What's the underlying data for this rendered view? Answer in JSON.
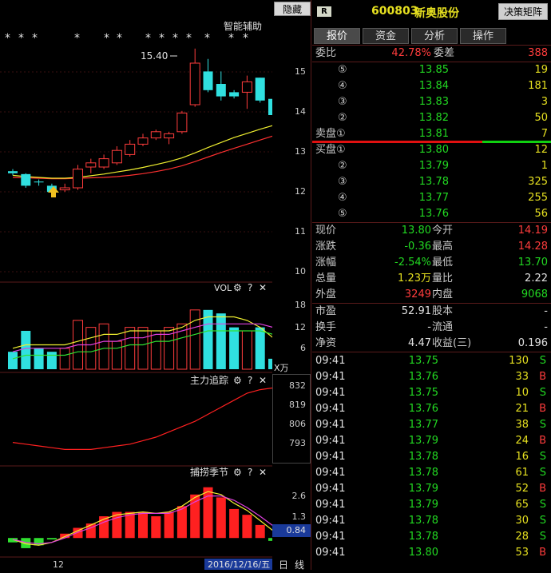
{
  "left_panel": {
    "hide_button": "隐藏>>",
    "smart_label": "智能辅助",
    "stars": [
      "*",
      "*",
      "*",
      "*",
      "*",
      "*",
      "*",
      "*",
      "*",
      "*",
      "*",
      "*",
      "*"
    ],
    "price_ticks": [
      "15",
      "14",
      "13",
      "12",
      "11",
      "10"
    ],
    "high_marker": "15.40",
    "vol_title": "VOL",
    "vol_ticks": [
      "18",
      "12",
      "6"
    ],
    "vol_unit": "X万",
    "main_title": "主力追踪",
    "main_ticks": [
      "832",
      "819",
      "806",
      "793"
    ],
    "season_title": "捕捞季节",
    "season_ticks": [
      "2.6",
      "1.3"
    ],
    "season_value": "0.84",
    "date_tick": "12",
    "date_label": "2016/12/16/五",
    "right_tail_1": "日",
    "right_tail_2": "线",
    "gear_icon": "⚙",
    "help_icon": "?",
    "close_icon": "✕"
  },
  "colors": {
    "up": "#ff3c3c",
    "down": "#30e0e0",
    "ma_yellow": "#f0f030",
    "ma_red": "#ff3030",
    "bg": "#000000",
    "grid": "#5a1a1a"
  },
  "header": {
    "badge": "R",
    "code": "600803",
    "name": "新奥股份",
    "decision_button": "决策矩阵"
  },
  "tabs": [
    "报价",
    "资金",
    "分析",
    "操作"
  ],
  "order_book": {
    "wei_bi_label": "委比",
    "wei_bi": "42.78%",
    "wei_cha_label": "委差",
    "wei_cha": "388",
    "asks": [
      {
        "level": "⑤",
        "price": "13.85",
        "vol": "19"
      },
      {
        "level": "④",
        "price": "13.84",
        "vol": "181"
      },
      {
        "level": "③",
        "price": "13.83",
        "vol": "3"
      },
      {
        "level": "②",
        "price": "13.82",
        "vol": "50"
      },
      {
        "level": "卖盘①",
        "price": "13.81",
        "vol": "7"
      }
    ],
    "bids": [
      {
        "level": "买盘①",
        "price": "13.80",
        "vol": "12"
      },
      {
        "level": "②",
        "price": "13.79",
        "vol": "1"
      },
      {
        "level": "③",
        "price": "13.78",
        "vol": "325"
      },
      {
        "level": "④",
        "price": "13.77",
        "vol": "255"
      },
      {
        "level": "⑤",
        "price": "13.76",
        "vol": "56"
      }
    ]
  },
  "quote": [
    {
      "l1": "现价",
      "v1": "13.80",
      "c1": "green",
      "l2": "今开",
      "v2": "14.19",
      "c2": "red"
    },
    {
      "l1": "涨跌",
      "v1": "-0.36",
      "c1": "green",
      "l2": "最高",
      "v2": "14.28",
      "c2": "red"
    },
    {
      "l1": "涨幅",
      "v1": "-2.54%",
      "c1": "green",
      "l2": "最低",
      "v2": "13.70",
      "c2": "green"
    },
    {
      "l1": "总量",
      "v1": "1.23万",
      "c1": "yellow",
      "l2": "量比",
      "v2": "2.22",
      "c2": "white"
    },
    {
      "l1": "外盘",
      "v1": "3249",
      "c1": "red",
      "l2": "内盘",
      "v2": "9068",
      "c2": "green"
    }
  ],
  "fundamentals": [
    {
      "l1": "市盈",
      "v1": "52.91",
      "l2": "股本",
      "v2": "-"
    },
    {
      "l1": "换手",
      "v1": "-",
      "l2": "流通",
      "v2": "-"
    },
    {
      "l1": "净资",
      "v1": "4.47",
      "l2": "收益(三)",
      "v2": "0.196"
    }
  ],
  "ticks": [
    {
      "time": "09:41",
      "price": "13.75",
      "vol": "130",
      "side": "S"
    },
    {
      "time": "09:41",
      "price": "13.76",
      "vol": "33",
      "side": "B"
    },
    {
      "time": "09:41",
      "price": "13.75",
      "vol": "10",
      "side": "S"
    },
    {
      "time": "09:41",
      "price": "13.76",
      "vol": "21",
      "side": "B"
    },
    {
      "time": "09:41",
      "price": "13.77",
      "vol": "38",
      "side": "S"
    },
    {
      "time": "09:41",
      "price": "13.79",
      "vol": "24",
      "side": "B"
    },
    {
      "time": "09:41",
      "price": "13.78",
      "vol": "16",
      "side": "S"
    },
    {
      "time": "09:41",
      "price": "13.78",
      "vol": "61",
      "side": "S"
    },
    {
      "time": "09:41",
      "price": "13.79",
      "vol": "52",
      "side": "B"
    },
    {
      "time": "09:41",
      "price": "13.79",
      "vol": "65",
      "side": "S"
    },
    {
      "time": "09:41",
      "price": "13.78",
      "vol": "30",
      "side": "S"
    },
    {
      "time": "09:41",
      "price": "13.78",
      "vol": "28",
      "side": "S"
    },
    {
      "time": "09:41",
      "price": "13.80",
      "vol": "53",
      "side": "B"
    }
  ],
  "chart_data": {
    "type": "candlestick",
    "candles": [
      {
        "o": 12.45,
        "c": 12.4,
        "h": 12.5,
        "l": 12.35
      },
      {
        "o": 12.38,
        "c": 12.1,
        "h": 12.4,
        "l": 12.05
      },
      {
        "o": 12.2,
        "c": 12.18,
        "h": 12.25,
        "l": 12.1
      },
      {
        "o": 12.1,
        "c": 11.95,
        "h": 12.15,
        "l": 11.9
      },
      {
        "o": 12.0,
        "c": 12.05,
        "h": 12.15,
        "l": 11.95
      },
      {
        "o": 12.05,
        "c": 12.5,
        "h": 12.6,
        "l": 12.0
      },
      {
        "o": 12.55,
        "c": 12.65,
        "h": 12.75,
        "l": 12.4
      },
      {
        "o": 12.55,
        "c": 12.75,
        "h": 12.85,
        "l": 12.5
      },
      {
        "o": 12.65,
        "c": 12.95,
        "h": 13.05,
        "l": 12.6
      },
      {
        "o": 12.85,
        "c": 13.1,
        "h": 13.2,
        "l": 12.8
      },
      {
        "o": 13.1,
        "c": 13.25,
        "h": 13.35,
        "l": 13.05
      },
      {
        "o": 13.25,
        "c": 13.4,
        "h": 13.45,
        "l": 13.2
      },
      {
        "o": 13.25,
        "c": 13.35,
        "h": 13.4,
        "l": 13.1
      },
      {
        "o": 13.4,
        "c": 13.85,
        "h": 13.9,
        "l": 13.35
      },
      {
        "o": 14.05,
        "c": 15.05,
        "h": 15.4,
        "l": 14.0
      },
      {
        "o": 14.85,
        "c": 14.4,
        "h": 15.15,
        "l": 14.35
      },
      {
        "o": 14.55,
        "c": 14.25,
        "h": 14.85,
        "l": 14.15
      },
      {
        "o": 14.35,
        "c": 14.25,
        "h": 14.4,
        "l": 14.2
      },
      {
        "o": 14.35,
        "c": 14.6,
        "h": 14.75,
        "l": 13.95
      },
      {
        "o": 14.7,
        "c": 14.15,
        "h": 14.7,
        "l": 14.1
      },
      {
        "o": 14.19,
        "c": 13.8,
        "h": 14.28,
        "l": 13.7
      }
    ],
    "ma_fast": [
      12.35,
      12.32,
      12.3,
      12.28,
      12.28,
      12.3,
      12.34,
      12.38,
      12.43,
      12.48,
      12.54,
      12.61,
      12.68,
      12.77,
      12.89,
      13.02,
      13.14,
      13.26,
      13.36,
      13.46,
      13.55
    ],
    "ma_slow": [
      12.3,
      12.29,
      12.28,
      12.27,
      12.27,
      12.28,
      12.29,
      12.3,
      12.32,
      12.35,
      12.39,
      12.44,
      12.5,
      12.58,
      12.68,
      12.79,
      12.9,
      13.0,
      13.1,
      13.2,
      13.3
    ],
    "price_range": [
      9.8,
      15.8
    ],
    "volume": [
      5,
      11,
      6,
      5,
      6,
      14,
      12,
      13,
      8,
      12,
      12,
      11,
      12,
      13,
      17,
      17,
      16,
      12,
      11,
      12,
      3
    ],
    "vol_ma1": [
      6,
      7,
      7,
      7,
      7,
      8,
      9,
      10,
      10,
      11,
      11,
      11,
      11,
      12,
      14,
      15,
      15,
      15,
      14,
      12,
      9
    ],
    "vol_ma2": [
      5,
      6,
      6,
      6,
      6,
      7,
      7,
      8,
      8,
      9,
      9,
      10,
      10,
      11,
      12,
      13,
      13,
      13,
      13,
      13,
      12
    ],
    "vol_range": [
      0,
      22
    ],
    "main_line": [
      800,
      799,
      798,
      797,
      796,
      796,
      796,
      797,
      798,
      799,
      801,
      803,
      806,
      809,
      812,
      816,
      820,
      824,
      828,
      830,
      831
    ],
    "main_range": [
      788,
      838
    ],
    "season_bars": [
      -0.3,
      -0.7,
      -0.5,
      -0.1,
      0.3,
      0.7,
      1.0,
      1.5,
      1.8,
      1.8,
      1.8,
      1.5,
      1.8,
      2.2,
      3.0,
      3.5,
      2.8,
      2.0,
      1.6,
      0.9,
      -0.2
    ],
    "season_line1": [
      -0.1,
      -0.4,
      -0.5,
      -0.3,
      0.1,
      0.5,
      0.9,
      1.3,
      1.6,
      1.7,
      1.8,
      1.7,
      1.8,
      2.2,
      2.8,
      3.2,
      3.0,
      2.4,
      1.9,
      1.2,
      0.5
    ],
    "season_line2": [
      -0.1,
      -0.3,
      -0.4,
      -0.3,
      0.0,
      0.4,
      0.7,
      1.1,
      1.4,
      1.6,
      1.7,
      1.7,
      1.7,
      2.0,
      2.5,
      2.9,
      2.9,
      2.6,
      2.1,
      1.5,
      0.84
    ],
    "season_range": [
      -1.2,
      4.2
    ]
  }
}
